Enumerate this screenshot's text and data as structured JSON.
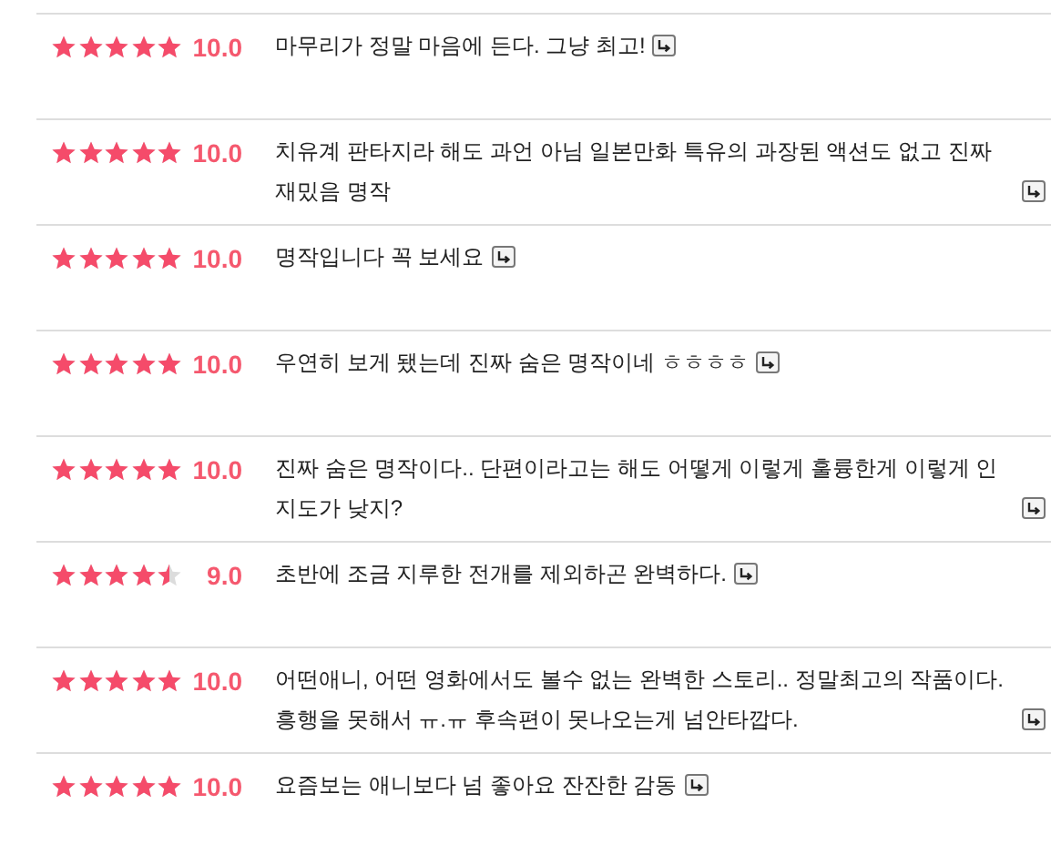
{
  "reviews": [
    {
      "stars": 5,
      "score": "10.0",
      "text": "마무리가 정말 마음에 든다. 그냥 최고!"
    },
    {
      "stars": 5,
      "score": "10.0",
      "text": "치유계 판타지라 해도 과언 아님 일본만화 특유의 과장된 액션도 없고 진짜 재밌음 명작"
    },
    {
      "stars": 5,
      "score": "10.0",
      "text": "명작입니다 꼭 보세요"
    },
    {
      "stars": 5,
      "score": "10.0",
      "text": "우연히 보게 됐는데 진짜 숨은 명작이네 ㅎㅎㅎㅎ"
    },
    {
      "stars": 5,
      "score": "10.0",
      "text": "진짜 숨은 명작이다.. 단편이라고는 해도 어떻게 이렇게 훌륭한게 이렇게 인지도가 낮지?"
    },
    {
      "stars": 4.5,
      "score": "9.0",
      "text": "초반에 조금 지루한 전개를 제외하곤 완벽하다."
    },
    {
      "stars": 5,
      "score": "10.0",
      "text": "어떤애니, 어떤 영화에서도 볼수 없는 완벽한 스토리.. 정말최고의 작품이다. 흥행을 못해서 ㅠ.ㅠ 후속편이 못나오는게 넘안타깝다."
    },
    {
      "stars": 5,
      "score": "10.0",
      "text": "요즘보는 애니보다 넘 좋아요 잔잔한 감동"
    }
  ]
}
